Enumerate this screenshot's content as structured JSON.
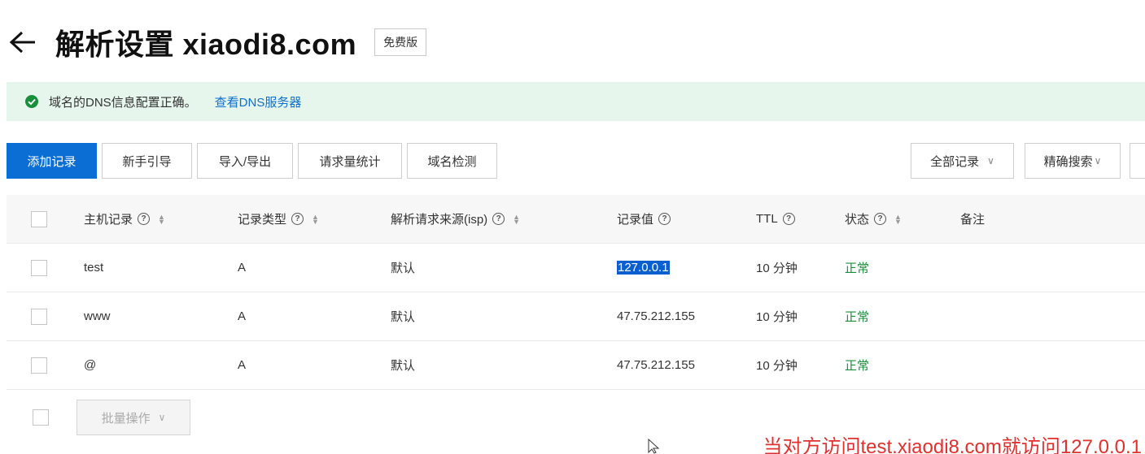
{
  "header": {
    "title": "解析设置 xiaodi8.com",
    "plan_badge": "免费版"
  },
  "alert": {
    "message": "域名的DNS信息配置正确。",
    "link": "查看DNS服务器"
  },
  "toolbar": {
    "add_record": "添加记录",
    "guide": "新手引导",
    "import_export": "导入/导出",
    "request_stats": "请求量统计",
    "domain_check": "域名检测",
    "all_records": "全部记录",
    "precise_search": "精确搜索"
  },
  "table": {
    "columns": {
      "host": "主机记录",
      "type": "记录类型",
      "isp": "解析请求来源(isp)",
      "value": "记录值",
      "ttl": "TTL",
      "status": "状态",
      "remark": "备注"
    },
    "rows": [
      {
        "host": "test",
        "type": "A",
        "isp": "默认",
        "value": "127.0.0.1",
        "ttl": "10 分钟",
        "status": "正常",
        "remark": ""
      },
      {
        "host": "www",
        "type": "A",
        "isp": "默认",
        "value": "47.75.212.155",
        "ttl": "10 分钟",
        "status": "正常",
        "remark": ""
      },
      {
        "host": "@",
        "type": "A",
        "isp": "默认",
        "value": "47.75.212.155",
        "ttl": "10 分钟",
        "status": "正常",
        "remark": ""
      }
    ]
  },
  "footer": {
    "batch_ops": "批量操作"
  },
  "caption": "当对方访问test.xiaodi8.com就访问127.0.0.1",
  "colors": {
    "primary": "#0a6ed4",
    "status_ok": "#1a8f3b",
    "alert_bg": "#e6f6ec",
    "caption": "#e2302d"
  }
}
